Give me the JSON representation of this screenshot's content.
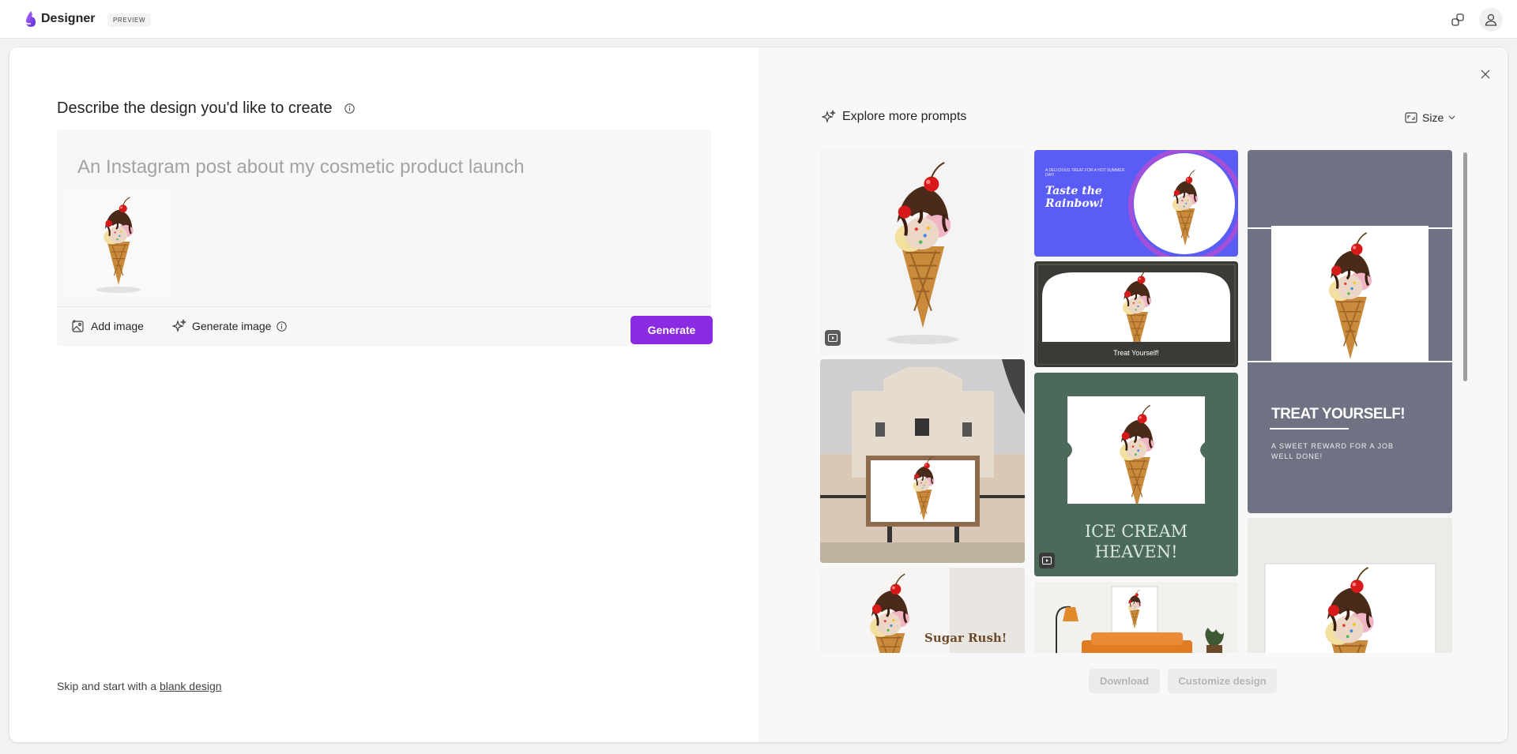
{
  "header": {
    "app_name": "Designer",
    "badge": "PREVIEW",
    "icons": [
      "designer-logo-icon",
      "share-icon",
      "account-icon"
    ]
  },
  "left": {
    "heading": "Describe the design you'd like to create",
    "prompt_placeholder": "An Instagram post about my cosmetic product launch",
    "add_image_label": "Add image",
    "generate_image_label": "Generate image",
    "generate_button": "Generate",
    "skip_prefix": "Skip and start with a",
    "skip_link": "blank design"
  },
  "right": {
    "explore_label": "Explore more prompts",
    "size_label": "Size",
    "download_label": "Download",
    "customize_label": "Customize design",
    "designs": [
      {
        "kind": "photo",
        "video": true
      },
      {
        "kind": "banner",
        "small_text": "A DELICIOUS TREAT FOR A HOT SUMMER DAY!",
        "headline": "Taste the Rainbow!"
      },
      {
        "kind": "framed",
        "caption": "Treat Yourself!"
      },
      {
        "kind": "poster",
        "headline": "TREAT YOURSELF!",
        "subline": "A SWEET REWARD FOR A JOB WELL DONE!"
      },
      {
        "kind": "billboard"
      },
      {
        "kind": "ticket",
        "headline": "ICE CREAM HEAVEN!",
        "video": true
      },
      {
        "kind": "sugar",
        "headline": "Sugar Rush!"
      },
      {
        "kind": "interior"
      },
      {
        "kind": "frame-wall"
      }
    ]
  },
  "colors": {
    "accent": "#8a2be2",
    "banner_blue": "#5a5df5",
    "poster_slate": "#6f7283",
    "ticket_green": "#4b6a5a",
    "board_dark": "#3a3a36"
  }
}
